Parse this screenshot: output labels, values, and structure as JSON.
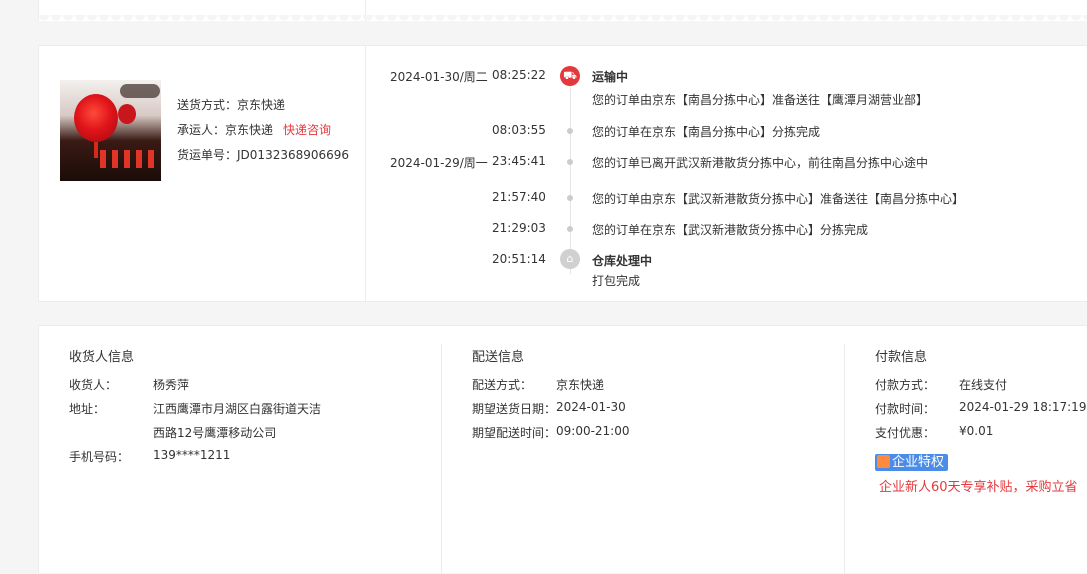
{
  "shipping": {
    "method_label": "送货方式：",
    "method": "京东快递",
    "carrier_label": "承运人：",
    "carrier": "京东快递",
    "consult": "快递咨询",
    "waybill_label": "货运单号：",
    "waybill": "JD0132368906696"
  },
  "timeline": [
    {
      "date": "2024-01-30/周二",
      "time": "08:25:22",
      "status": "运输中",
      "desc": "您的订单由京东【南昌分拣中心】准备送往【鹰潭月湖营业部】"
    },
    {
      "date": "",
      "time": "08:03:55",
      "status": "",
      "desc": "您的订单在京东【南昌分拣中心】分拣完成"
    },
    {
      "date": "2024-01-29/周一",
      "time": "23:45:41",
      "status": "",
      "desc": "您的订单已离开武汉新港散货分拣中心，前往南昌分拣中心途中"
    },
    {
      "date": "",
      "time": "21:57:40",
      "status": "",
      "desc": "您的订单由京东【武汉新港散货分拣中心】准备送往【南昌分拣中心】"
    },
    {
      "date": "",
      "time": "21:29:03",
      "status": "",
      "desc": "您的订单在京东【武汉新港散货分拣中心】分拣完成"
    },
    {
      "date": "",
      "time": "20:51:14",
      "status": "仓库处理中",
      "desc": "打包完成"
    }
  ],
  "receiver": {
    "title": "收货人信息",
    "name_label": "收货人：",
    "name": "杨秀萍",
    "address_label": "地址：",
    "address_line1": "江西鹰潭市月湖区白露街道天洁",
    "address_line2": "西路12号鹰潭移动公司",
    "phone_label": "手机号码：",
    "phone": "139****1211"
  },
  "delivery": {
    "title": "配送信息",
    "method_label": "配送方式：",
    "method": "京东快递",
    "date_label": "期望送货日期：",
    "date": "2024-01-30",
    "time_label": "期望配送时间：",
    "time": "09:00-21:00"
  },
  "payment": {
    "title": "付款信息",
    "method_label": "付款方式：",
    "method": "在线支付",
    "time_label": "付款时间：",
    "time": "2024-01-29 18:17:19",
    "discount_label": "支付优惠：",
    "discount": "¥0.01",
    "badge": "企业特权",
    "promo": "企业新人60天专享补贴，采购立省"
  },
  "colors": {
    "accent": "#e4393c",
    "badge": "#4a8ce8"
  }
}
